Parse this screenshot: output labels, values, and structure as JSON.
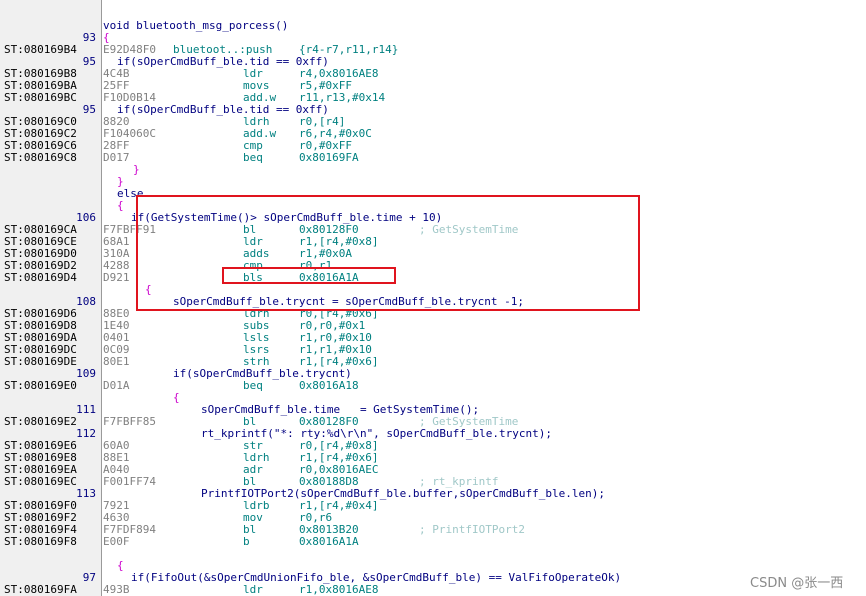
{
  "lines": [
    {
      "num": "",
      "addr": "",
      "src": "",
      "indent": 0
    },
    {
      "num": "",
      "addr": "",
      "src": "void bluetooth_msg_porcess()",
      "indent": 0
    },
    {
      "num": "93",
      "addr": "",
      "src": "{",
      "indent": 0,
      "bracket": true
    },
    {
      "num": "",
      "addr": "ST:080169B4",
      "op": "E92D48F0",
      "mn": "bluetoot..:push",
      "args": "{r4-r7,r11,r14}",
      "asm": true,
      "mnleft": true
    },
    {
      "num": "95",
      "addr": "",
      "src": "if(sOperCmdBuff_ble.tid == 0xff)",
      "indent": 14
    },
    {
      "num": "",
      "addr": "ST:080169B8",
      "op": "4C4B",
      "mn": "ldr",
      "args": "r4,0x8016AE8",
      "asm": true
    },
    {
      "num": "",
      "addr": "ST:080169BA",
      "op": "25FF",
      "mn": "movs",
      "args": "r5,#0xFF",
      "asm": true
    },
    {
      "num": "",
      "addr": "ST:080169BC",
      "op": "F10D0B14",
      "mn": "add.w",
      "args": "r11,r13,#0x14",
      "asm": true
    },
    {
      "num": "95",
      "addr": "",
      "src": "if(sOperCmdBuff_ble.tid == 0xff)",
      "indent": 14
    },
    {
      "num": "",
      "addr": "ST:080169C0",
      "op": "8820",
      "mn": "ldrh",
      "args": "r0,[r4]",
      "asm": true
    },
    {
      "num": "",
      "addr": "ST:080169C2",
      "op": "F104060C",
      "mn": "add.w",
      "args": "r6,r4,#0x0C",
      "asm": true
    },
    {
      "num": "",
      "addr": "ST:080169C6",
      "op": "28FF",
      "mn": "cmp",
      "args": "r0,#0xFF",
      "asm": true
    },
    {
      "num": "",
      "addr": "ST:080169C8",
      "op": "D017",
      "mn": "beq",
      "args": "0x80169FA",
      "asm": true
    },
    {
      "num": "",
      "addr": "",
      "src": "}",
      "indent": 30,
      "bracket": true
    },
    {
      "num": "",
      "addr": "",
      "src": "}",
      "indent": 14,
      "bracket": true
    },
    {
      "num": "",
      "addr": "",
      "src": "else",
      "indent": 14,
      "kw": true
    },
    {
      "num": "",
      "addr": "",
      "src": "{",
      "indent": 14,
      "bracket": true
    },
    {
      "num": "106",
      "addr": "",
      "src": "if(GetSystemTime()> sOperCmdBuff_ble.time + 10)",
      "indent": 28
    },
    {
      "num": "",
      "addr": "ST:080169CA",
      "op": "F7FBFF91",
      "mn": "bl",
      "args": "0x80128F0",
      "cmt": "; GetSystemTime",
      "asm": true
    },
    {
      "num": "",
      "addr": "ST:080169CE",
      "op": "68A1",
      "mn": "ldr",
      "args": "r1,[r4,#0x8]",
      "asm": true
    },
    {
      "num": "",
      "addr": "ST:080169D0",
      "op": "310A",
      "mn": "adds",
      "args": "r1,#0x0A",
      "asm": true
    },
    {
      "num": "",
      "addr": "ST:080169D2",
      "op": "4288",
      "mn": "cmp",
      "args": "r0,r1",
      "asm": true
    },
    {
      "num": "",
      "addr": "ST:080169D4",
      "op": "D921",
      "mn": "bls",
      "args": "0x8016A1A",
      "asm": true
    },
    {
      "num": "",
      "addr": "",
      "src": "{",
      "indent": 42,
      "bracket": true
    },
    {
      "num": "108",
      "addr": "",
      "src": "sOperCmdBuff_ble.trycnt = sOperCmdBuff_ble.trycnt -1;",
      "indent": 70
    },
    {
      "num": "",
      "addr": "ST:080169D6",
      "op": "88E0",
      "mn": "ldrh",
      "args": "r0,[r4,#0x6]",
      "asm": true
    },
    {
      "num": "",
      "addr": "ST:080169D8",
      "op": "1E40",
      "mn": "subs",
      "args": "r0,r0,#0x1",
      "asm": true
    },
    {
      "num": "",
      "addr": "ST:080169DA",
      "op": "0401",
      "mn": "lsls",
      "args": "r1,r0,#0x10",
      "asm": true
    },
    {
      "num": "",
      "addr": "ST:080169DC",
      "op": "0C09",
      "mn": "lsrs",
      "args": "r1,r1,#0x10",
      "asm": true
    },
    {
      "num": "",
      "addr": "ST:080169DE",
      "op": "80E1",
      "mn": "strh",
      "args": "r1,[r4,#0x6]",
      "asm": true
    },
    {
      "num": "109",
      "addr": "",
      "src": "if(sOperCmdBuff_ble.trycnt)",
      "indent": 70
    },
    {
      "num": "",
      "addr": "ST:080169E0",
      "op": "D01A",
      "mn": "beq",
      "args": "0x8016A18",
      "asm": true
    },
    {
      "num": "",
      "addr": "",
      "src": "{",
      "indent": 70,
      "bracket": true
    },
    {
      "num": "111",
      "addr": "",
      "src": "sOperCmdBuff_ble.time   = GetSystemTime();",
      "indent": 98
    },
    {
      "num": "",
      "addr": "ST:080169E2",
      "op": "F7FBFF85",
      "mn": "bl",
      "args": "0x80128F0",
      "cmt": "; GetSystemTime",
      "asm": true
    },
    {
      "num": "112",
      "addr": "",
      "src": "rt_kprintf(\"*: rty:%d\\r\\n\", sOperCmdBuff_ble.trycnt);",
      "indent": 98
    },
    {
      "num": "",
      "addr": "ST:080169E6",
      "op": "60A0",
      "mn": "str",
      "args": "r0,[r4,#0x8]",
      "asm": true
    },
    {
      "num": "",
      "addr": "ST:080169E8",
      "op": "88E1",
      "mn": "ldrh",
      "args": "r1,[r4,#0x6]",
      "asm": true
    },
    {
      "num": "",
      "addr": "ST:080169EA",
      "op": "A040",
      "mn": "adr",
      "args": "r0,0x8016AEC",
      "asm": true
    },
    {
      "num": "",
      "addr": "ST:080169EC",
      "op": "F001FF74",
      "mn": "bl",
      "args": "0x80188D8",
      "cmt": "; rt_kprintf",
      "asm": true
    },
    {
      "num": "113",
      "addr": "",
      "src": "PrintfIOTPort2(sOperCmdBuff_ble.buffer,sOperCmdBuff_ble.len);",
      "indent": 98
    },
    {
      "num": "",
      "addr": "ST:080169F0",
      "op": "7921",
      "mn": "ldrb",
      "args": "r1,[r4,#0x4]",
      "asm": true
    },
    {
      "num": "",
      "addr": "ST:080169F2",
      "op": "4630",
      "mn": "mov",
      "args": "r0,r6",
      "asm": true
    },
    {
      "num": "",
      "addr": "ST:080169F4",
      "op": "F7FDF894",
      "mn": "bl",
      "args": "0x8013B20",
      "cmt": "; PrintfIOTPort2",
      "asm": true
    },
    {
      "num": "",
      "addr": "ST:080169F8",
      "op": "E00F",
      "mn": "b",
      "args": "0x8016A1A",
      "asm": true
    },
    {
      "num": "",
      "addr": "",
      "src": "",
      "indent": 0
    },
    {
      "num": "",
      "addr": "",
      "src": "{",
      "indent": 14,
      "bracket": true
    },
    {
      "num": "97",
      "addr": "",
      "src": "if(FifoOut(&sOperCmdUnionFifo_ble, &sOperCmdBuff_ble) == ValFifoOperateOk)",
      "indent": 28
    },
    {
      "num": "",
      "addr": "ST:080169FA",
      "op": "493B",
      "mn": "ldr",
      "args": "r1,0x8016AE8",
      "asm": true
    }
  ],
  "watermark": "CSDN @张一西"
}
